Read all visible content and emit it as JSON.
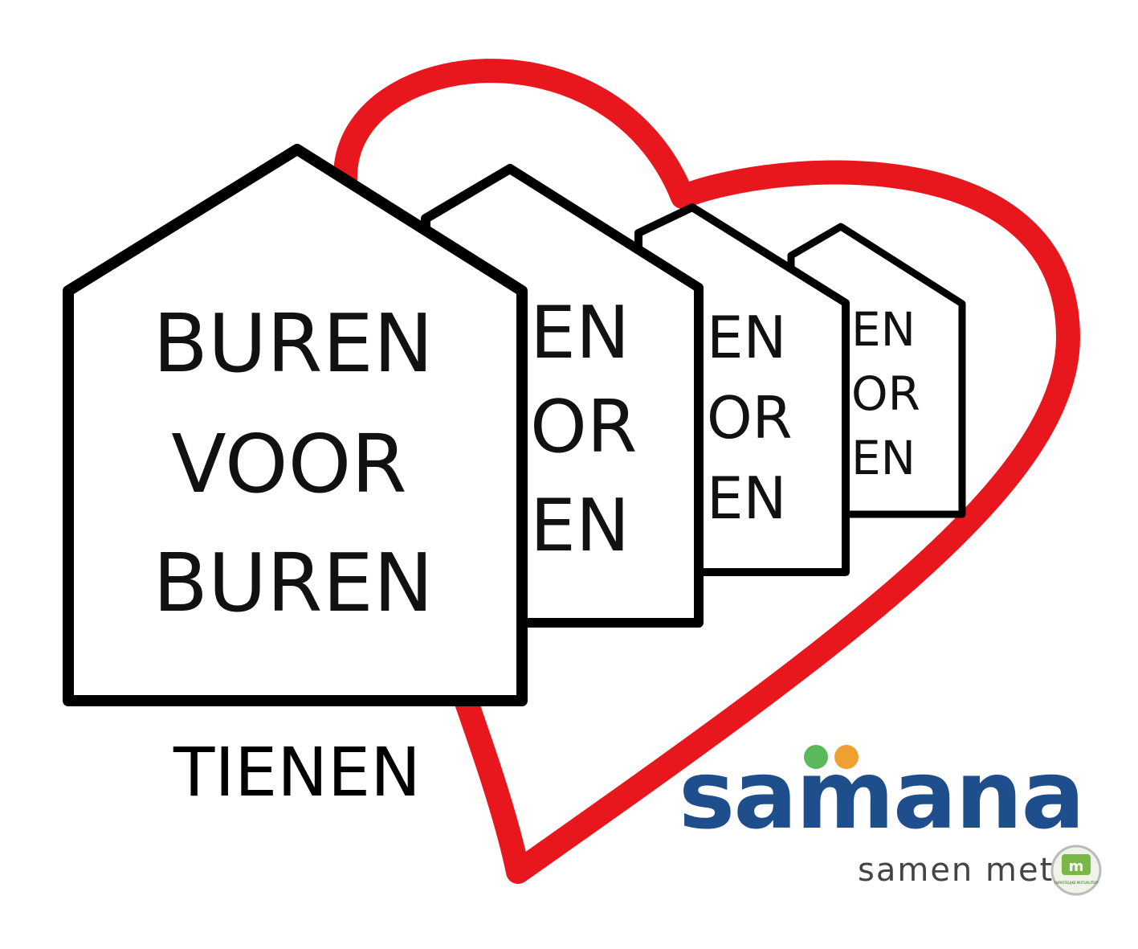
{
  "logo": {
    "houses": [
      {
        "line1": "BUREN",
        "line2": "VOOR",
        "line3": "BUREN"
      },
      {
        "line1": "EN",
        "line2": "OR",
        "line3": "EN"
      },
      {
        "line1": "EN",
        "line2": "OR",
        "line3": "EN"
      },
      {
        "line1": "EN",
        "line2": "OR",
        "line3": "EN"
      }
    ],
    "city": "TIENEN",
    "heart_color": "#e8171e"
  },
  "partner": {
    "brand": "samana",
    "brand_color": "#1f4e8c",
    "dot_colors": [
      "#5cb85c",
      "#f0a030"
    ],
    "tagline": "samen met",
    "badge_text": "CHRISTELIJKE MUTUALITEIT",
    "badge_color": "#7ab648"
  }
}
